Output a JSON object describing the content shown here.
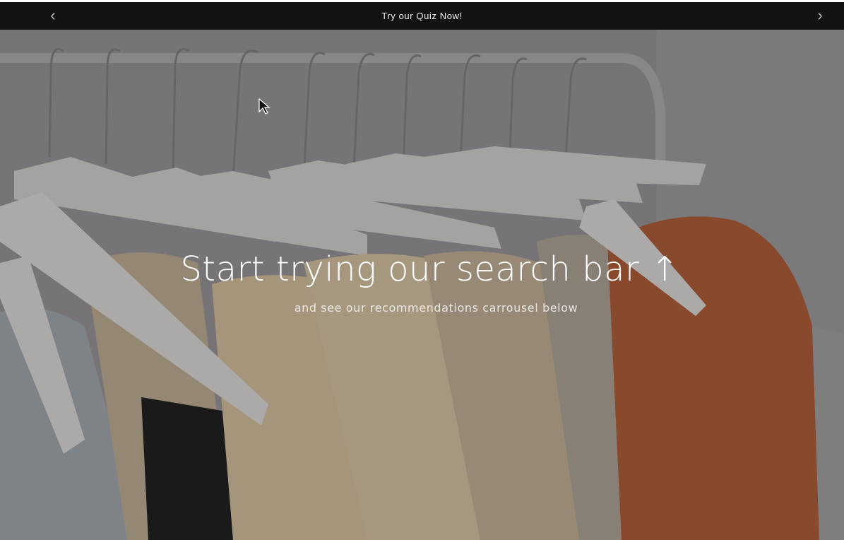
{
  "announcement_bar": {
    "message": "Try our Quiz Now!",
    "prev_icon": "chevron-left-icon",
    "next_icon": "chevron-right-icon"
  },
  "hero": {
    "heading": "Start trying our search bar ↑",
    "subheading": "and see our recommendations carrousel below",
    "background": "clothes-on-hangers-rack-image"
  },
  "colors": {
    "announcement_bg": "#121212",
    "announcement_text": "#f3f3f3",
    "hero_text": "#ffffff",
    "sweater_orange": "#b8562a",
    "sweater_cream": "#e8d6b8"
  }
}
